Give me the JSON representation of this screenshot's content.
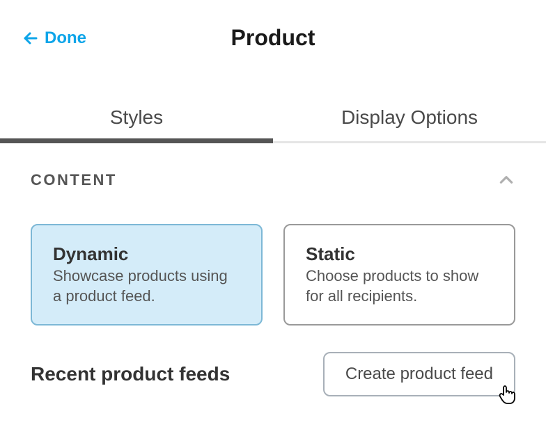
{
  "header": {
    "back_label": "Done",
    "title": "Product"
  },
  "tabs": [
    {
      "label": "Styles",
      "active": true
    },
    {
      "label": "Display Options",
      "active": false
    }
  ],
  "section": {
    "title": "CONTENT"
  },
  "options": [
    {
      "title": "Dynamic",
      "description": "Showcase products using a product feed.",
      "selected": true
    },
    {
      "title": "Static",
      "description": "Choose products to show for all recipients.",
      "selected": false
    }
  ],
  "feeds": {
    "title": "Recent product feeds",
    "create_button": "Create product feed"
  }
}
